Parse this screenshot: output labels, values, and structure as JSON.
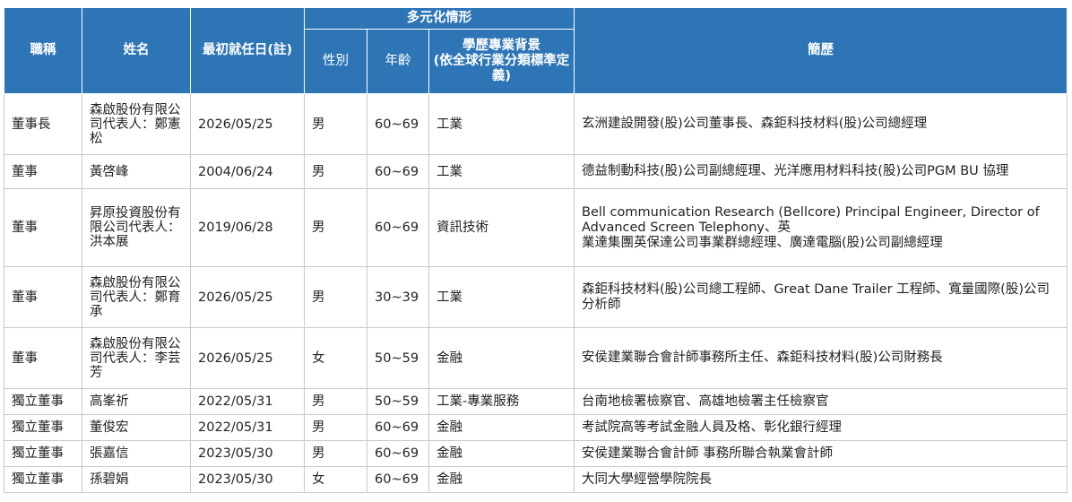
{
  "headers": {
    "title": "職稱",
    "name": "姓名",
    "start_date": "最初就任日(註)",
    "diversity": "多元化情形",
    "gender": "性別",
    "age": "年齡",
    "education": "學歷專業背景\n(依全球行業分類標準定義)",
    "resume": "簡歷"
  },
  "rows": [
    {
      "title": "董事長",
      "name": "森啟股份有限公司代表人：鄭憲松",
      "date": "2026/05/25",
      "gender": "男",
      "age": "60~69",
      "edu": "工業",
      "resume": "玄洲建設開發(股)公司董事長、森鉅科技材料(股)公司總經理"
    },
    {
      "title": "董事",
      "name": "黃啓峰",
      "date": "2004/06/24",
      "gender": "男",
      "age": "60~69",
      "edu": "工業",
      "resume": "德益制動科技(股)公司副總經理、光洋應用材料科技(股)公司PGM BU 協理"
    },
    {
      "title": "董事",
      "name": "昇原投資股份有限公司代表人：洪本展",
      "date": "2019/06/28",
      "gender": "男",
      "age": "60~69",
      "edu": "資訊技術",
      "resume": "Bell communication Research (Bellcore) Principal Engineer, Director of Advanced Screen Telephony、英\n業達集團英保達公司事業群總經理、廣達電腦(股)公司副總經理"
    },
    {
      "title": "董事",
      "name": "森啟股份有限公司代表人：鄭育承",
      "date": "2026/05/25",
      "gender": "男",
      "age": "30~39",
      "edu": "工業",
      "resume": "森鉅科技材料(股)公司總工程師、Great Dane Trailer 工程師、寬量國際(股)公司分析師"
    },
    {
      "title": "董事",
      "name": "森啟股份有限公司代表人：李芸芳",
      "date": "2026/05/25",
      "gender": "女",
      "age": "50~59",
      "edu": "金融",
      "resume": "安侯建業聯合會計師事務所主任、森鉅科技材料(股)公司財務長"
    },
    {
      "title": "獨立董事",
      "name": "高峯祈",
      "date": "2022/05/31",
      "gender": "男",
      "age": "50~59",
      "edu": "工業-專業服務",
      "resume": "台南地檢署檢察官、高雄地檢署主任檢察官"
    },
    {
      "title": "獨立董事",
      "name": "董俊宏",
      "date": "2022/05/31",
      "gender": "男",
      "age": "60~69",
      "edu": "金融",
      "resume": "考試院高等考試金融人員及格、彰化銀行經理"
    },
    {
      "title": "獨立董事",
      "name": "張嘉信",
      "date": "2023/05/30",
      "gender": "男",
      "age": "60~69",
      "edu": "金融",
      "resume": "安侯建業聯合會計師 事務所聯合執業會計師"
    },
    {
      "title": "獨立董事",
      "name": "孫碧娟",
      "date": "2023/05/30",
      "gender": "女",
      "age": "60~69",
      "edu": "金融",
      "resume": "大同大學經營學院院長"
    }
  ]
}
